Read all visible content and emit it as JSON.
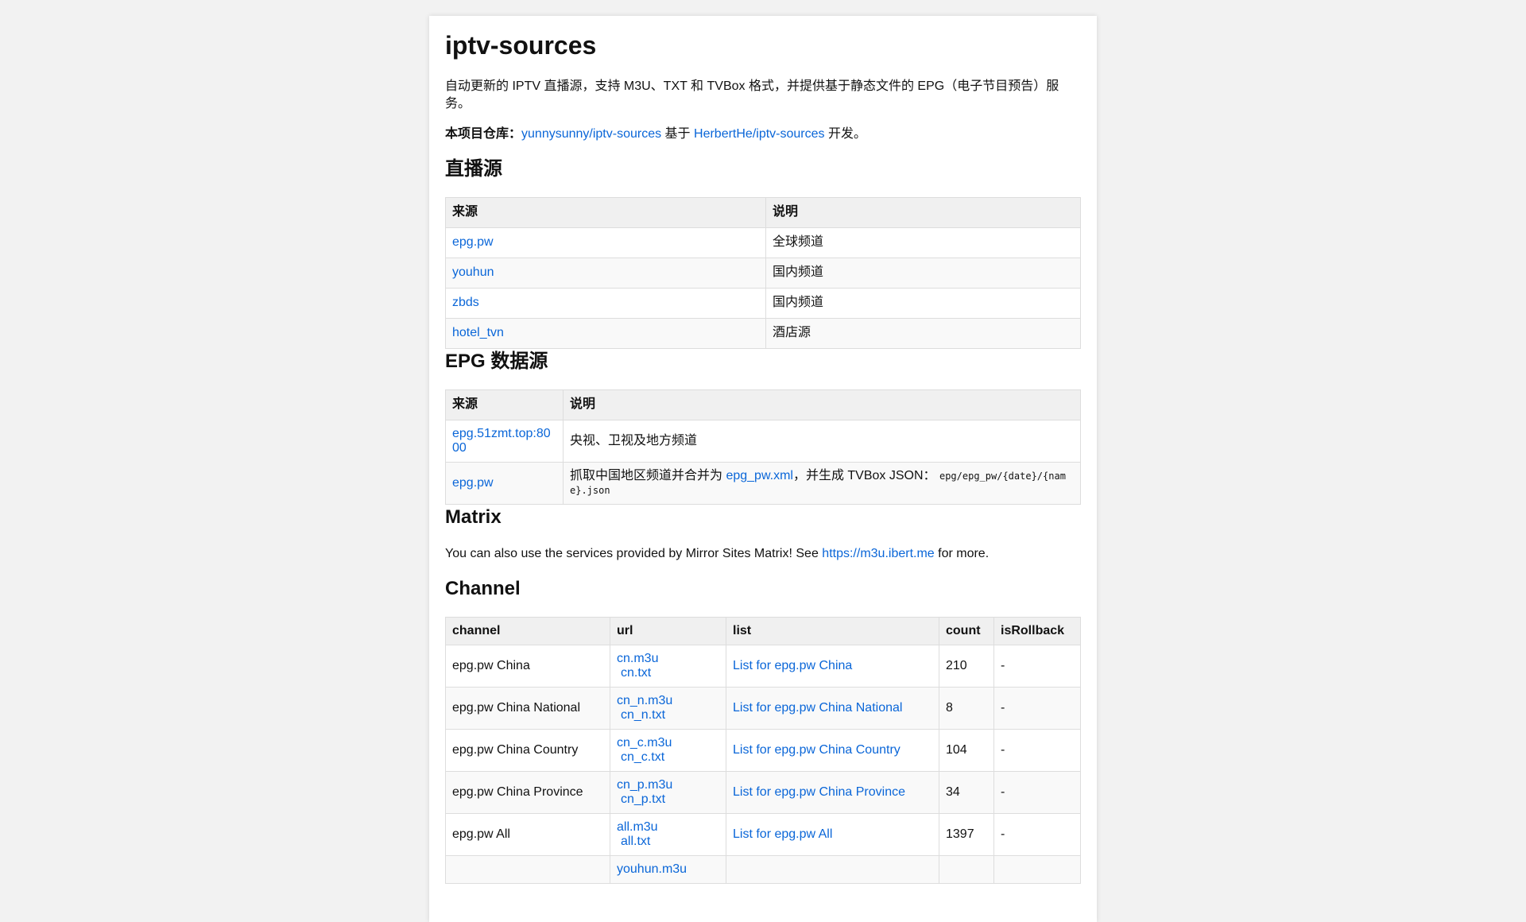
{
  "title": "iptv-sources",
  "intro": "自动更新的 IPTV 直播源，支持 M3U、TXT 和 TVBox 格式，并提供基于静态文件的 EPG（电子节目预告）服务。",
  "repo": {
    "label": "本项目仓库：",
    "link1": "yunnysunny/iptv-sources",
    "mid": " 基于 ",
    "link2": "HerbertHe/iptv-sources",
    "end": " 开发。"
  },
  "live": {
    "heading": "直播源",
    "headers": [
      "来源",
      "说明"
    ],
    "rows": [
      {
        "source": "epg.pw",
        "desc": "全球频道"
      },
      {
        "source": "youhun",
        "desc": "国内频道"
      },
      {
        "source": "zbds",
        "desc": "国内频道"
      },
      {
        "source": "hotel_tvn",
        "desc": "酒店源"
      }
    ]
  },
  "epg": {
    "heading": "EPG 数据源",
    "headers": [
      "来源",
      "说明"
    ],
    "rows": [
      {
        "source": "epg.51zmt.top:8000",
        "desc": "央视、卫视及地方频道"
      },
      {
        "source": "epg.pw",
        "desc_pre": "抓取中国地区频道并合并为 ",
        "desc_link": "epg_pw.xml",
        "desc_mid": "，并生成 TVBox JSON： ",
        "desc_code": "epg/epg_pw/{date}/{name}.json"
      }
    ]
  },
  "matrix": {
    "heading": "Matrix",
    "text_pre": "You can also use the services provided by Mirror Sites Matrix! See ",
    "link": "https://m3u.ibert.me",
    "text_post": " for more."
  },
  "channel": {
    "heading": "Channel",
    "headers": [
      "channel",
      "url",
      "list",
      "count",
      "isRollback"
    ],
    "rows": [
      {
        "channel": "epg.pw China",
        "m3u": "cn.m3u",
        "txt": "cn.txt",
        "list": "List for epg.pw China",
        "count": "210",
        "rollback": "-"
      },
      {
        "channel": "epg.pw China National",
        "m3u": "cn_n.m3u",
        "txt": "cn_n.txt",
        "list": "List for epg.pw China National",
        "count": "8",
        "rollback": "-"
      },
      {
        "channel": "epg.pw China Country",
        "m3u": "cn_c.m3u",
        "txt": "cn_c.txt",
        "list": "List for epg.pw China Country",
        "count": "104",
        "rollback": "-"
      },
      {
        "channel": "epg.pw China Province",
        "m3u": "cn_p.m3u",
        "txt": "cn_p.txt",
        "list": "List for epg.pw China Province",
        "count": "34",
        "rollback": "-"
      },
      {
        "channel": "epg.pw All",
        "m3u": "all.m3u",
        "txt": "all.txt",
        "list": "List for epg.pw All",
        "count": "1397",
        "rollback": "-"
      },
      {
        "channel": "",
        "m3u": "youhun.m3u",
        "txt": "",
        "list": "",
        "count": "",
        "rollback": ""
      }
    ]
  }
}
